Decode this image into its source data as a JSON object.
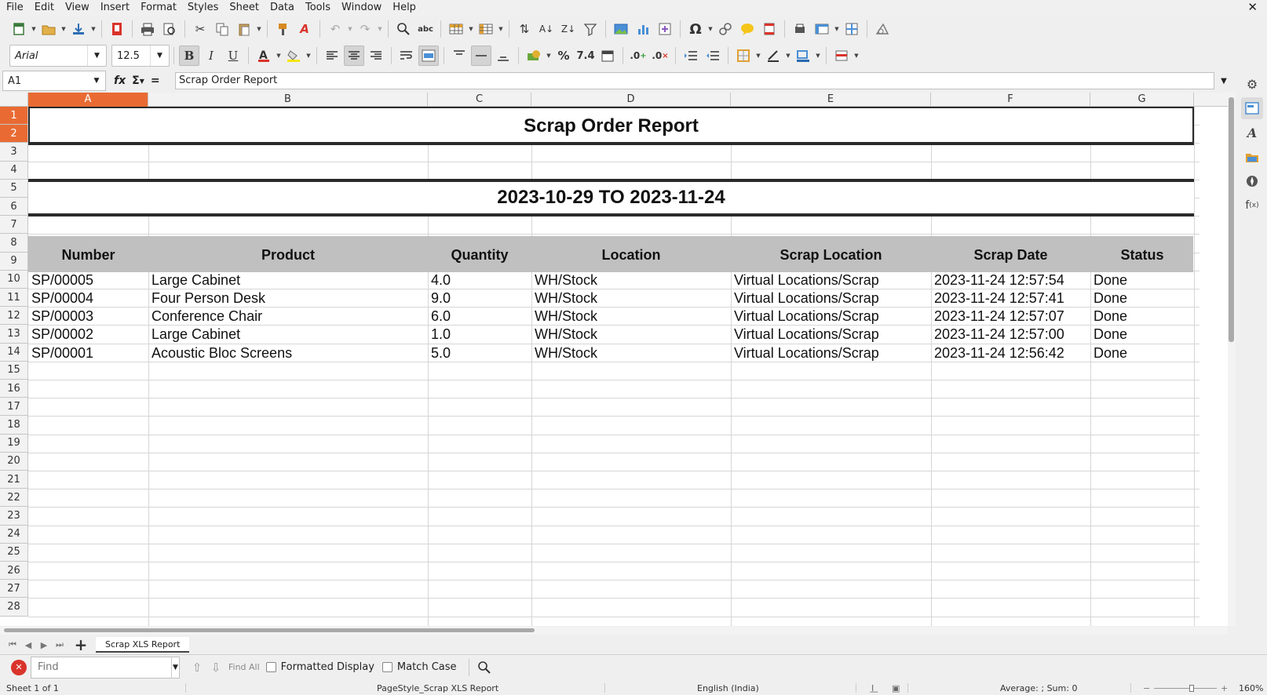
{
  "menu": [
    "File",
    "Edit",
    "View",
    "Insert",
    "Format",
    "Styles",
    "Sheet",
    "Data",
    "Tools",
    "Window",
    "Help"
  ],
  "window_close": "✕",
  "font": {
    "name": "Arial",
    "size": "12.5"
  },
  "name_box": "A1",
  "formula_content": "Scrap Order Report",
  "formula_icons": {
    "fx": "fx",
    "sigma": "Σ",
    "equals": "="
  },
  "columns": [
    "A",
    "B",
    "C",
    "D",
    "E",
    "F",
    "G"
  ],
  "rows": [
    "1",
    "2",
    "3",
    "4",
    "5",
    "6",
    "7",
    "8",
    "9",
    "10",
    "11",
    "12",
    "13",
    "14",
    "15",
    "16",
    "17",
    "18",
    "19",
    "20",
    "21",
    "22",
    "23",
    "24",
    "25",
    "26",
    "27",
    "28"
  ],
  "sheet": {
    "title": "Scrap Order Report",
    "date_range": "2023-10-29 TO 2023-11-24",
    "headers": [
      "Number",
      "Product",
      "Quantity",
      "Location",
      "Scrap Location",
      "Scrap Date",
      "Status"
    ],
    "records": [
      [
        "SP/00005",
        "Large Cabinet",
        "4.0",
        "WH/Stock",
        "Virtual Locations/Scrap",
        "2023-11-24 12:57:54",
        "Done"
      ],
      [
        "SP/00004",
        "Four Person Desk",
        "9.0",
        "WH/Stock",
        "Virtual Locations/Scrap",
        "2023-11-24 12:57:41",
        "Done"
      ],
      [
        "SP/00003",
        "Conference Chair",
        "6.0",
        "WH/Stock",
        "Virtual Locations/Scrap",
        "2023-11-24 12:57:07",
        "Done"
      ],
      [
        "SP/00002",
        "Large Cabinet",
        "1.0",
        "WH/Stock",
        "Virtual Locations/Scrap",
        "2023-11-24 12:57:00",
        "Done"
      ],
      [
        "SP/00001",
        "Acoustic Bloc Screens",
        "5.0",
        "WH/Stock",
        "Virtual Locations/Scrap",
        "2023-11-24 12:56:42",
        "Done"
      ]
    ]
  },
  "sheet_tab": "Scrap XLS Report",
  "find": {
    "placeholder": "Find",
    "find_all": "Find All",
    "formatted_display": "Formatted Display",
    "match_case": "Match Case"
  },
  "status": {
    "sheet": "Sheet 1 of 1",
    "page_style": "PageStyle_Scrap XLS Report",
    "language": "English (India)",
    "summary": "Average: ; Sum: 0",
    "zoom": "160%"
  },
  "colors": {
    "active_header": "#e96b33",
    "table_header_bg": "#c0c0c0"
  }
}
